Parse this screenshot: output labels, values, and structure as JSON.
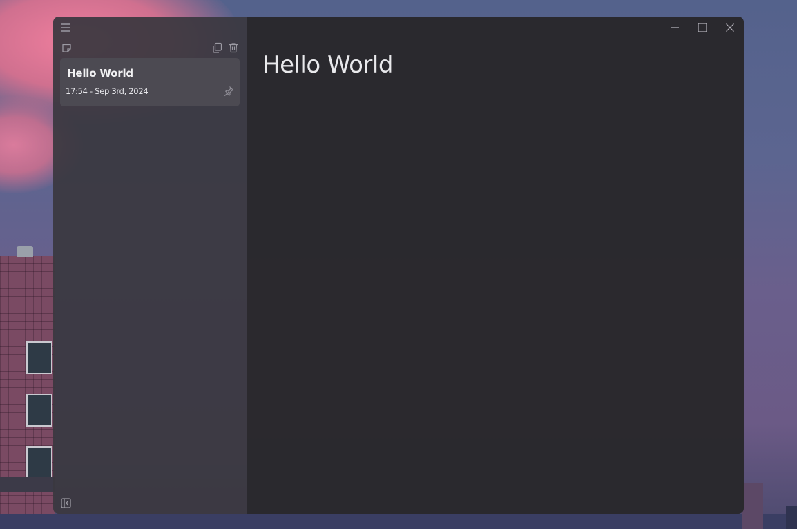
{
  "colors": {
    "sidebar_bg": "#3a3840",
    "editor_bg": "#2a292d",
    "card_bg": "#4c4a52",
    "icon": "#9c9aa3",
    "text": "#f1f1f3"
  },
  "icons": {
    "menu": "hamburger-menu-icon",
    "new_note": "new-note-icon",
    "duplicate": "duplicate-icon",
    "delete": "trash-icon",
    "pin": "pin-icon",
    "collapse": "collapse-sidebar-icon",
    "minimize": "minimize-icon",
    "maximize": "maximize-icon",
    "close": "close-icon"
  },
  "notes": [
    {
      "title": "Hello World",
      "date": "17:54 - Sep 3rd, 2024"
    }
  ],
  "editor": {
    "title": "Hello World"
  }
}
